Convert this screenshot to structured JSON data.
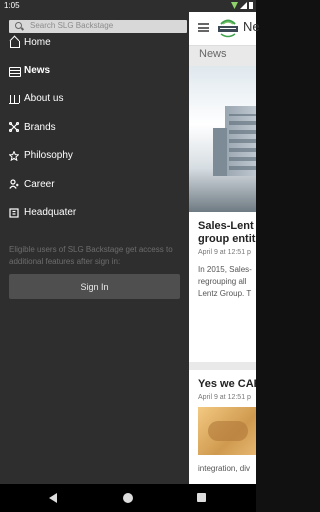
{
  "status_bar": {
    "time": "1:05",
    "icons": [
      "wifi-icon",
      "signal-icon",
      "battery-icon"
    ]
  },
  "drawer": {
    "search": {
      "placeholder": "Search SLG Backstage"
    },
    "menu": [
      {
        "label": "Home",
        "icon": "home-icon",
        "active": false
      },
      {
        "label": "News",
        "icon": "news-icon",
        "active": true
      },
      {
        "label": "About us",
        "icon": "about-icon",
        "active": false
      },
      {
        "label": "Brands",
        "icon": "brands-icon",
        "active": false
      },
      {
        "label": "Philosophy",
        "icon": "star-icon",
        "active": false
      },
      {
        "label": "Career",
        "icon": "career-icon",
        "active": false
      },
      {
        "label": "Headquater",
        "icon": "headquater-icon",
        "active": false
      }
    ],
    "info_text": "Eligible users of SLG Backstage get access to\nadditional features after sign in:",
    "sign_in_label": "Sign In"
  },
  "app": {
    "logo_icon": "backstage-logo-icon",
    "title": "Ne",
    "section_label": "News",
    "cards": [
      {
        "title": "Sales-Lent\ngroup entit",
        "date": "April 9 at 12:51 p",
        "text": "In 2015, Sales-\nregrouping all\nLentz Group. T"
      },
      {
        "title": "Yes we CAR",
        "date": "April 9 at 12:51 p",
        "text": "integration, div"
      }
    ]
  },
  "nav_bar": {
    "icons": [
      "back-icon",
      "home-button-icon",
      "recents-icon"
    ]
  },
  "colors": {
    "drawer_bg": "#2e2e2e",
    "app_bg": "#e9e9e9",
    "button_bg": "#4f4f4f",
    "logo_green": "#3fa34d"
  }
}
